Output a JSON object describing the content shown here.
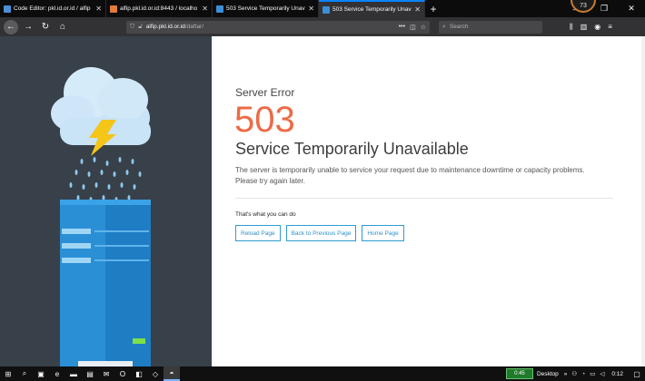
{
  "tabs": [
    {
      "title": "Code Editor: pkl.id.or.id / alfip",
      "active": false,
      "favicon_color": "#4a90d9"
    },
    {
      "title": "alfip.pkl.id.or.id:8443 / localho",
      "active": false,
      "favicon_color": "#e07b39"
    },
    {
      "title": "503 Service Temporarily Unava",
      "active": false,
      "favicon_color": "#3a8fd8"
    },
    {
      "title": "503 Service Temporarily Unava",
      "active": true,
      "favicon_color": "#3a8fd8"
    }
  ],
  "window": {
    "badge_count": "73"
  },
  "navbar": {
    "url_host": "alfip.pkl.id.or.id",
    "url_path": "/daftar/",
    "search_placeholder": "Search"
  },
  "page": {
    "label": "Server Error",
    "code": "503",
    "headline": "Service Temporarily Unavailable",
    "description": "The server is temporarily unable to service your request due to maintenance downtime or capacity problems. Please try again later.",
    "actions_label": "That's what you can do",
    "actions": [
      "Reload Page",
      "Back to Previous Page",
      "Home Page"
    ]
  },
  "taskbar": {
    "battery_time": "0:45",
    "desktop_label": "Desktop",
    "clock": "0:12"
  },
  "colors": {
    "accent": "#ec6b47",
    "button_border": "#2f9bd5",
    "illustration_bg": "#384049"
  }
}
